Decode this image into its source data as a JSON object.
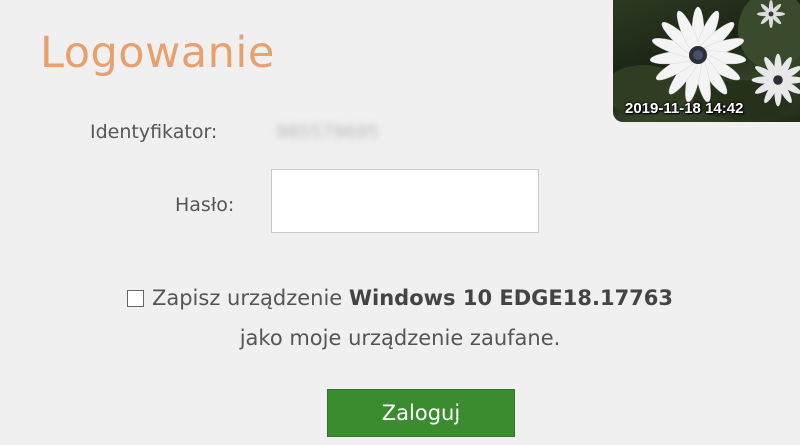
{
  "title": "Logowanie",
  "thumbnail": {
    "timestamp": "2019-11-18 14:42",
    "icon": "daisy-flower-photo"
  },
  "form": {
    "identifier_label": "Identyfikator:",
    "identifier_value": "985579695",
    "password_label": "Hasło:",
    "password_value": ""
  },
  "remember": {
    "text_before": "Zapisz urządzenie ",
    "device": "Windows 10 EDGE18.17763",
    "text_after": "jako moje urządzenie zaufane.",
    "checked": false
  },
  "login_button": "Zaloguj",
  "colors": {
    "title": "#e8a06e",
    "button": "#3a8c2f",
    "background": "#f0f0f0"
  }
}
